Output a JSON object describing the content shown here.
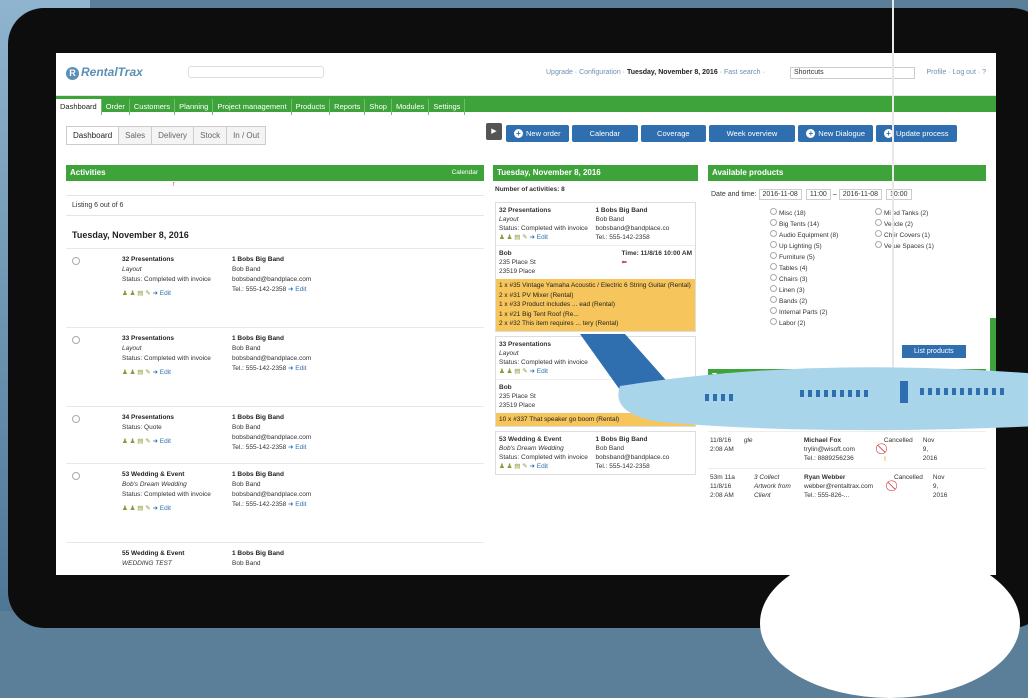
{
  "app": {
    "logo": "RentalTrax",
    "top_links": "Upgrade · Configuration · ",
    "top_date": "Tuesday, November 8, 2016",
    "fast_search": " · Fast search · ",
    "shortcuts": "Shortcuts",
    "profile_links": "Profile · Log out · ?"
  },
  "nav": [
    "Dashboard",
    "Order",
    "Customers",
    "Planning",
    "Project management",
    "Products",
    "Reports",
    "Shop",
    "Modules",
    "Settings"
  ],
  "subtabs": [
    "Dashboard",
    "Sales",
    "Delivery",
    "Stock",
    "In / Out"
  ],
  "actions": [
    "New order",
    "Calendar",
    "Coverage",
    "Week overview",
    "New Dialogue",
    "Update process"
  ],
  "activities": {
    "title": "Activities",
    "calendar_link": "Calendar",
    "listing": "Listing 6 out of 6",
    "day": "Tuesday, November 8, 2016",
    "rows": [
      {
        "title": "32 Presentations",
        "sub": "Layout",
        "status": "Status: Completed with invoice",
        "client": "1 Bobs Big Band",
        "contact": "Bob Band",
        "email": "bobsband@bandplace.com",
        "tel": "Tel.: 555-142-2358",
        "edit": "Edit"
      },
      {
        "title": "33 Presentations",
        "sub": "Layout",
        "status": "Status: Completed with invoice",
        "client": "1 Bobs Big Band",
        "contact": "Bob Band",
        "email": "bobsband@bandplace.com",
        "tel": "Tel.: 555-142-2358",
        "edit": "Edit"
      },
      {
        "title": "34 Presentations",
        "sub": "",
        "status": "Status: Quote",
        "client": "1 Bobs Big Band",
        "contact": "Bob Band",
        "email": "bobsband@bandplace.com",
        "tel": "Tel.: 555-142-2358",
        "edit": "Edit"
      },
      {
        "title": "53 Wedding & Event",
        "sub": "Bob's Dream Wedding",
        "status": "Status: Completed with invoice",
        "client": "1 Bobs Big Band",
        "contact": "Bob Band",
        "email": "bobsband@bandplace.com",
        "tel": "Tel.: 555-142-2358",
        "edit": "Edit"
      },
      {
        "title": "55 Wedding & Event",
        "sub": "WEDDING TEST",
        "status": "",
        "client": "1 Bobs Big Band",
        "contact": "Bob Band",
        "email": "",
        "tel": "",
        "edit": ""
      }
    ]
  },
  "middle": {
    "title": "Tuesday, November 8, 2016",
    "num": "Number of activities: 8",
    "card1": {
      "title": "32 Presentations",
      "sub": "Layout",
      "status": "Status: Completed with invoice",
      "client": "1 Bobs Big Band",
      "contact": "Bob Band",
      "email": "bobsband@bandplace.co",
      "tel": "Tel.: 555-142-2358",
      "edit": "Edit"
    },
    "bob1": {
      "name": "Bob",
      "time": "Time: 11/8/16 10:00 AM",
      "addr1": "235 Place St",
      "addr2": "23519 Place"
    },
    "items1": [
      "1 x #35 Vintage Yamaha Acoustic / Electric 6 String Guitar (Rental)",
      "2 x #31 PV Mixer (Rental)",
      "1 x #33 Product includes ... ead (Rental)",
      "1 x #21 Big Tent Roof (Re...",
      "2 x #32 This item requires ... tery (Rental)"
    ],
    "card2": {
      "title": "33 Presentations",
      "sub": "Layout",
      "status": "Status: Completed with invoice",
      "edit": "Edit"
    },
    "bob2": {
      "name": "Bob",
      "time": "Time: 11/8/16 10:00 AM",
      "addr1": "235 Place St",
      "addr2": "23519 Place"
    },
    "items2": [
      "10 x #337 That speaker go boom (Rental)"
    ],
    "card3": {
      "title": "53 Wedding & Event",
      "sub": "Bob's Dream Wedding",
      "status": "Status: Completed with invoice",
      "client": "1 Bobs Big Band",
      "contact": "Bob Band",
      "email": "bobsband@bandplace.co",
      "tel": "Tel.: 555-142-2358",
      "edit": "Edit"
    }
  },
  "available": {
    "title": "Available products",
    "date_label": "Date and time:",
    "from_date": "2016-11-08",
    "from_time": "11:00",
    "to_date": "2016-11-08",
    "to_time": "10:00",
    "col1": [
      "Misc (18)",
      "Big Tents (14)",
      "Audio Equipment (8)",
      "Up Lighting (5)",
      "Furniture (5)",
      "Tables (4)",
      "Chairs (3)",
      "Linen (3)",
      "Bands (2)",
      "Internal Parts (2)",
      "Labor (2)"
    ],
    "col2": [
      "Mi ed Tanks (2)",
      "Ve icle (2)",
      "Ch ir Covers (1)",
      "Ve ue Spaces (1)"
    ],
    "list_button": "List products"
  },
  "tasks": {
    "title": "Tasks",
    "rows": [
      {
        "date": "11/8/16",
        "time": "2:08 AM",
        "desc": "gle",
        "name": "Michael Fox",
        "email": "trylin@wisoft.com",
        "tel": "Tel.: 8889256236",
        "state": "Cancelled",
        "due": "Nov 9, 2016"
      },
      {
        "date": "53m 11a 11/8/16",
        "time": "2:08 AM",
        "desc": "3 Collect Artwork from Client",
        "name": "Ryan Webber",
        "email": "webber@rentaltrax.com",
        "tel": "Tel.: 555-826-...",
        "state": "Cancelled",
        "due": "Nov 9, 2016"
      }
    ]
  },
  "colors": {
    "green": "#3fa33b",
    "blue": "#2f6fb0",
    "highlight": "#f6c55b"
  }
}
